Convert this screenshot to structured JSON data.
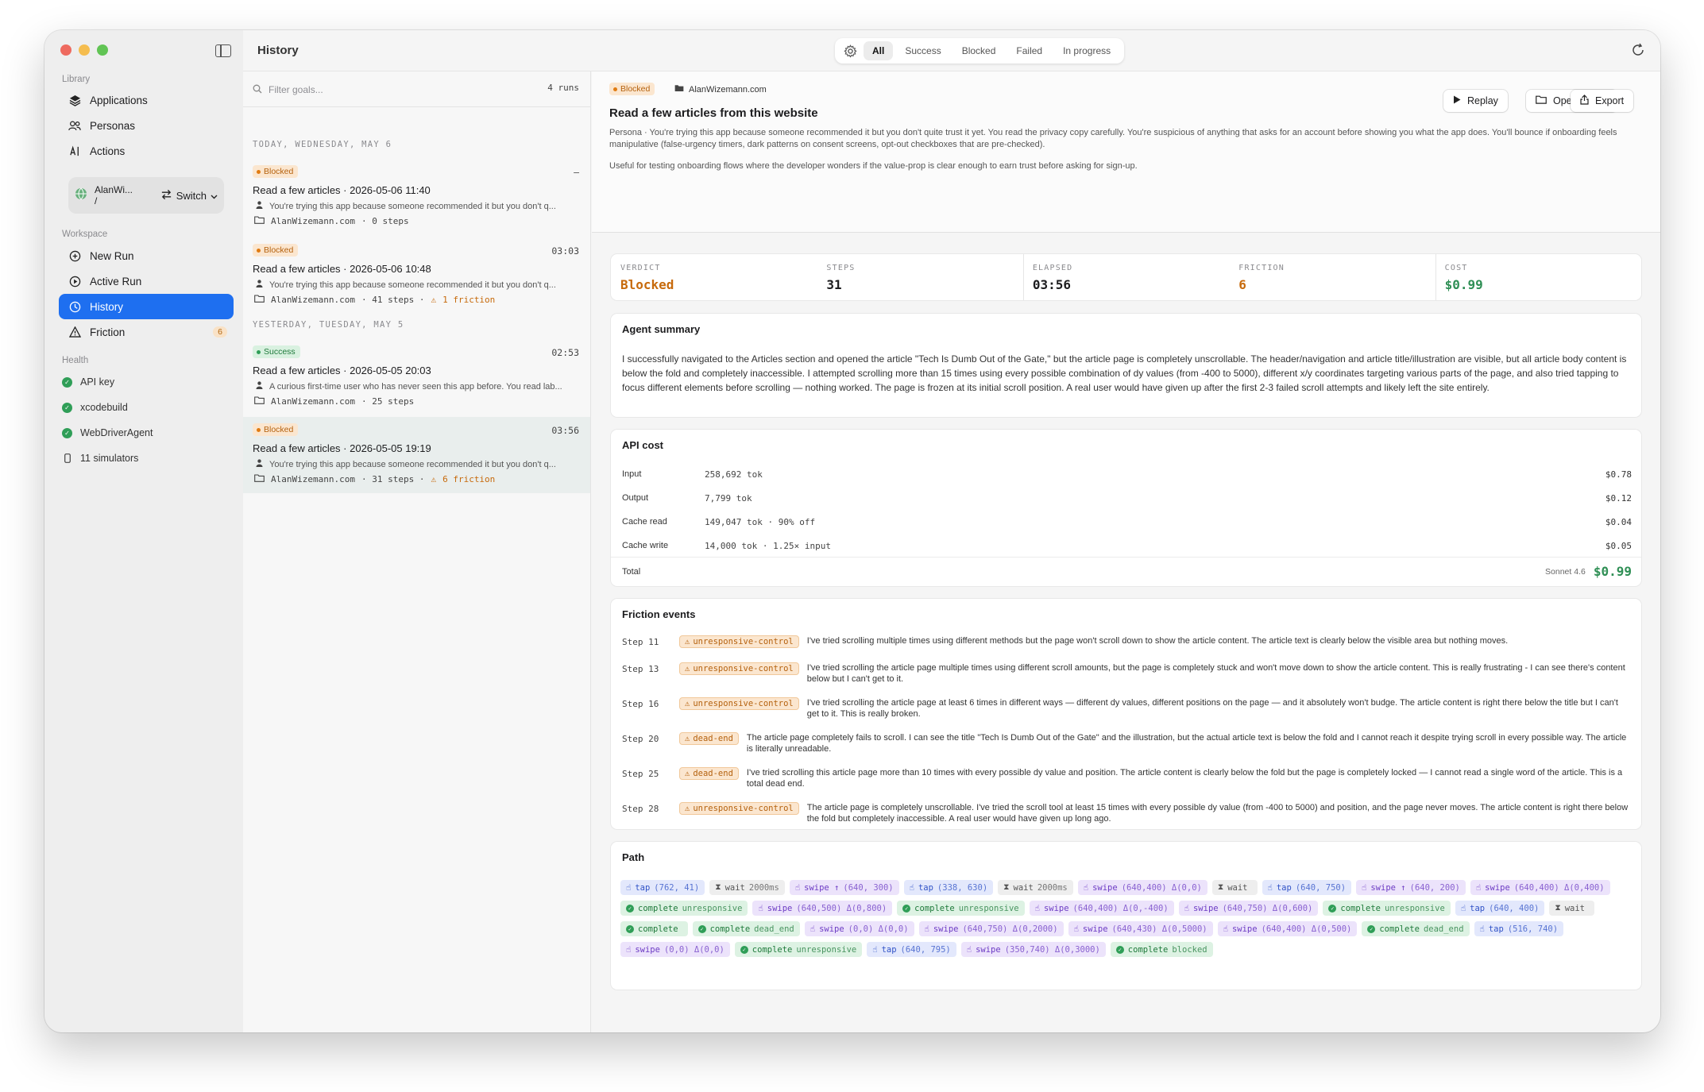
{
  "window": {
    "title": "History",
    "traffic_colors": [
      "#ee6a5f",
      "#f5bd4f",
      "#61c454"
    ]
  },
  "sidebar": {
    "library_label": "Library",
    "library_items": [
      {
        "label": "Applications",
        "icon": "layers-icon"
      },
      {
        "label": "Personas",
        "icon": "people-icon"
      },
      {
        "label": "Actions",
        "icon": "text-cursor-icon"
      }
    ],
    "account": {
      "name": "AlanWi...",
      "sub": "/",
      "switch_label": "Switch"
    },
    "workspace_label": "Workspace",
    "workspace_items": [
      {
        "label": "New Run",
        "icon": "plus-circle-icon"
      },
      {
        "label": "Active Run",
        "icon": "play-circle-icon"
      },
      {
        "label": "History",
        "icon": "clock-icon"
      },
      {
        "label": "Friction",
        "icon": "warning-icon",
        "badge": "6"
      }
    ],
    "health_label": "Health",
    "health_items": [
      {
        "label": "API key"
      },
      {
        "label": "xcodebuild"
      },
      {
        "label": "WebDriverAgent"
      },
      {
        "label": "11 simulators"
      }
    ]
  },
  "toolbar": {
    "filters": [
      "All",
      "Success",
      "Blocked",
      "Failed",
      "In progress"
    ],
    "active_filter": "All"
  },
  "runlist": {
    "filter_placeholder": "Filter goals...",
    "runs_count": "4 runs",
    "groups": [
      {
        "label": "TODAY, WEDNESDAY, MAY 6"
      },
      {
        "label": "YESTERDAY, TUESDAY, MAY 5"
      }
    ],
    "runs": [
      {
        "status": "Blocked",
        "time": "–",
        "title": "Read a few articles · 2026-05-06 11:40",
        "persona": "You're trying this app because someone recommended it but you don't q...",
        "site": "AlanWizemann.com",
        "steps": "· 0 steps",
        "friction": ""
      },
      {
        "status": "Blocked",
        "time": "03:03",
        "title": "Read a few articles · 2026-05-06 10:48",
        "persona": "You're trying this app because someone recommended it but you don't q...",
        "site": "AlanWizemann.com",
        "steps": "· 41 steps ·",
        "friction": "1 friction"
      },
      {
        "status": "Success",
        "time": "02:53",
        "title": "Read a few articles · 2026-05-05 20:03",
        "persona": "A curious first-time user who has never seen this app before. You read lab...",
        "site": "AlanWizemann.com",
        "steps": "· 25 steps",
        "friction": ""
      },
      {
        "status": "Blocked",
        "time": "03:56",
        "title": "Read a few articles · 2026-05-05 19:19",
        "persona": "You're trying this app because someone recommended it but you don't q...",
        "site": "AlanWizemann.com",
        "steps": "· 31 steps ·",
        "friction": "6 friction"
      }
    ]
  },
  "detail": {
    "status": "Blocked",
    "site": "AlanWizemann.com",
    "title": "Read a few articles from this website",
    "persona": "Persona · You're trying this app because someone recommended it but you don't quite trust it yet. You read the privacy copy carefully. You're suspicious of anything that asks for an account before showing you what the app does. You'll bounce if onboarding feels manipulative (false-urgency timers, dark patterns on consent screens, opt-out checkboxes that are pre-checked).",
    "useful": "Useful for testing onboarding flows where the developer wonders if the value-prop is clear enough to earn trust before asking for sign-up.",
    "buttons": {
      "replay": "Replay",
      "open_folder": "Open Folder",
      "export": "Export"
    },
    "stats": [
      {
        "label": "VERDICT",
        "value": "Blocked"
      },
      {
        "label": "STEPS",
        "value": "31"
      },
      {
        "label": "ELAPSED",
        "value": "03:56"
      },
      {
        "label": "FRICTION",
        "value": "6"
      },
      {
        "label": "COST",
        "value": "$0.99"
      }
    ],
    "summary_title": "Agent summary",
    "summary": "I successfully navigated to the Articles section and opened the article \"Tech Is Dumb Out of the Gate,\" but the article page is completely unscrollable. The header/navigation and article title/illustration are visible, but all article body content is below the fold and completely inaccessible. I attempted scrolling more than 15 times using every possible combination of dy values (from -400 to 5000), different x/y coordinates targeting various parts of the page, and also tried tapping to focus different elements before scrolling — nothing worked. The page is frozen at its initial scroll position. A real user would have given up after the first 2-3 failed scroll attempts and likely left the site entirely.",
    "api_cost_title": "API cost",
    "api_cost": [
      {
        "label": "Input",
        "tokens": "258,692 tok",
        "amount": "$0.78"
      },
      {
        "label": "Output",
        "tokens": "7,799 tok",
        "amount": "$0.12"
      },
      {
        "label": "Cache read",
        "tokens": "149,047 tok · 90% off",
        "amount": "$0.04"
      },
      {
        "label": "Cache write",
        "tokens": "14,000 tok · 1.25× input",
        "amount": "$0.05"
      }
    ],
    "total": {
      "label": "Total",
      "model": "Sonnet 4.6",
      "amount": "$0.99"
    },
    "friction_title": "Friction events",
    "friction_events": [
      {
        "step": "Step 11",
        "tag": "unresponsive-control",
        "text": "I've tried scrolling multiple times using different methods but the page won't scroll down to show the article content. The article text is clearly below the visible area but nothing moves."
      },
      {
        "step": "Step 13",
        "tag": "unresponsive-control",
        "text": "I've tried scrolling the article page multiple times using different scroll amounts, but the page is completely stuck and won't move down to show the article content. This is really frustrating - I can see there's content below but I can't get to it."
      },
      {
        "step": "Step 16",
        "tag": "unresponsive-control",
        "text": "I've tried scrolling the article page at least 6 times in different ways — different dy values, different positions on the page — and it absolutely won't budge. The article content is right there below the title but I can't get to it. This is really broken."
      },
      {
        "step": "Step 20",
        "tag": "dead-end",
        "text": "The article page completely fails to scroll. I can see the title \"Tech Is Dumb Out of the Gate\" and the illustration, but the actual article text is below the fold and I cannot reach it despite trying scroll in every possible way. The article is literally unreadable."
      },
      {
        "step": "Step 25",
        "tag": "dead-end",
        "text": "I've tried scrolling this article page more than 10 times with every possible dy value and position. The article content is clearly below the fold but the page is completely locked — I cannot read a single word of the article. This is a total dead end."
      },
      {
        "step": "Step 28",
        "tag": "unresponsive-control",
        "text": "The article page is completely unscrollable. I've tried the scroll tool at least 15 times with every possible dy value (from -400 to 5000) and position, and the page never moves. The article content is right there below the fold but completely inaccessible. A real user would have given up long ago."
      }
    ],
    "path_title": "Path",
    "path": [
      {
        "type": "tap",
        "label": "tap",
        "arg": "(762, 41)"
      },
      {
        "type": "wait",
        "label": "wait",
        "arg": "2000ms"
      },
      {
        "type": "swipe",
        "label": "swipe ↑",
        "arg": "(640, 300)"
      },
      {
        "type": "tap",
        "label": "tap",
        "arg": "(338, 630)"
      },
      {
        "type": "wait",
        "label": "wait",
        "arg": "2000ms"
      },
      {
        "type": "swipe",
        "label": "swipe",
        "arg": "(640,400) Δ(0,0)"
      },
      {
        "type": "wait",
        "label": "wait",
        "arg": ""
      },
      {
        "type": "tap",
        "label": "tap",
        "arg": "(640, 750)"
      },
      {
        "type": "swipe",
        "label": "swipe ↑",
        "arg": "(640, 200)"
      },
      {
        "type": "swipe",
        "label": "swipe",
        "arg": "(640,400) Δ(0,400)"
      },
      {
        "type": "complete",
        "label": "complete",
        "arg": "unresponsive"
      },
      {
        "type": "swipe",
        "label": "swipe",
        "arg": "(640,500) Δ(0,800)"
      },
      {
        "type": "complete",
        "label": "complete",
        "arg": "unresponsive"
      },
      {
        "type": "swipe",
        "label": "swipe",
        "arg": "(640,400) Δ(0,-400)"
      },
      {
        "type": "swipe",
        "label": "swipe",
        "arg": "(640,750) Δ(0,600)"
      },
      {
        "type": "complete",
        "label": "complete",
        "arg": "unresponsive"
      },
      {
        "type": "tap",
        "label": "tap",
        "arg": "(640, 400)"
      },
      {
        "type": "wait",
        "label": "wait",
        "arg": ""
      },
      {
        "type": "complete",
        "label": "complete",
        "arg": ""
      },
      {
        "type": "complete",
        "label": "complete",
        "arg": "dead_end"
      },
      {
        "type": "swipe",
        "label": "swipe",
        "arg": "(0,0) Δ(0,0)"
      },
      {
        "type": "swipe",
        "label": "swipe",
        "arg": "(640,750) Δ(0,2000)"
      },
      {
        "type": "swipe",
        "label": "swipe",
        "arg": "(640,430) Δ(0,5000)"
      },
      {
        "type": "swipe",
        "label": "swipe",
        "arg": "(640,400) Δ(0,500)"
      },
      {
        "type": "complete",
        "label": "complete",
        "arg": "dead_end"
      },
      {
        "type": "tap",
        "label": "tap",
        "arg": "(516, 740)"
      },
      {
        "type": "swipe",
        "label": "swipe",
        "arg": "(0,0) Δ(0,0)"
      },
      {
        "type": "complete",
        "label": "complete",
        "arg": "unresponsive"
      },
      {
        "type": "tap",
        "label": "tap",
        "arg": "(640, 795)"
      },
      {
        "type": "swipe",
        "label": "swipe",
        "arg": "(350,740) Δ(0,3000)"
      },
      {
        "type": "complete",
        "label": "complete",
        "arg": "blocked"
      }
    ]
  }
}
